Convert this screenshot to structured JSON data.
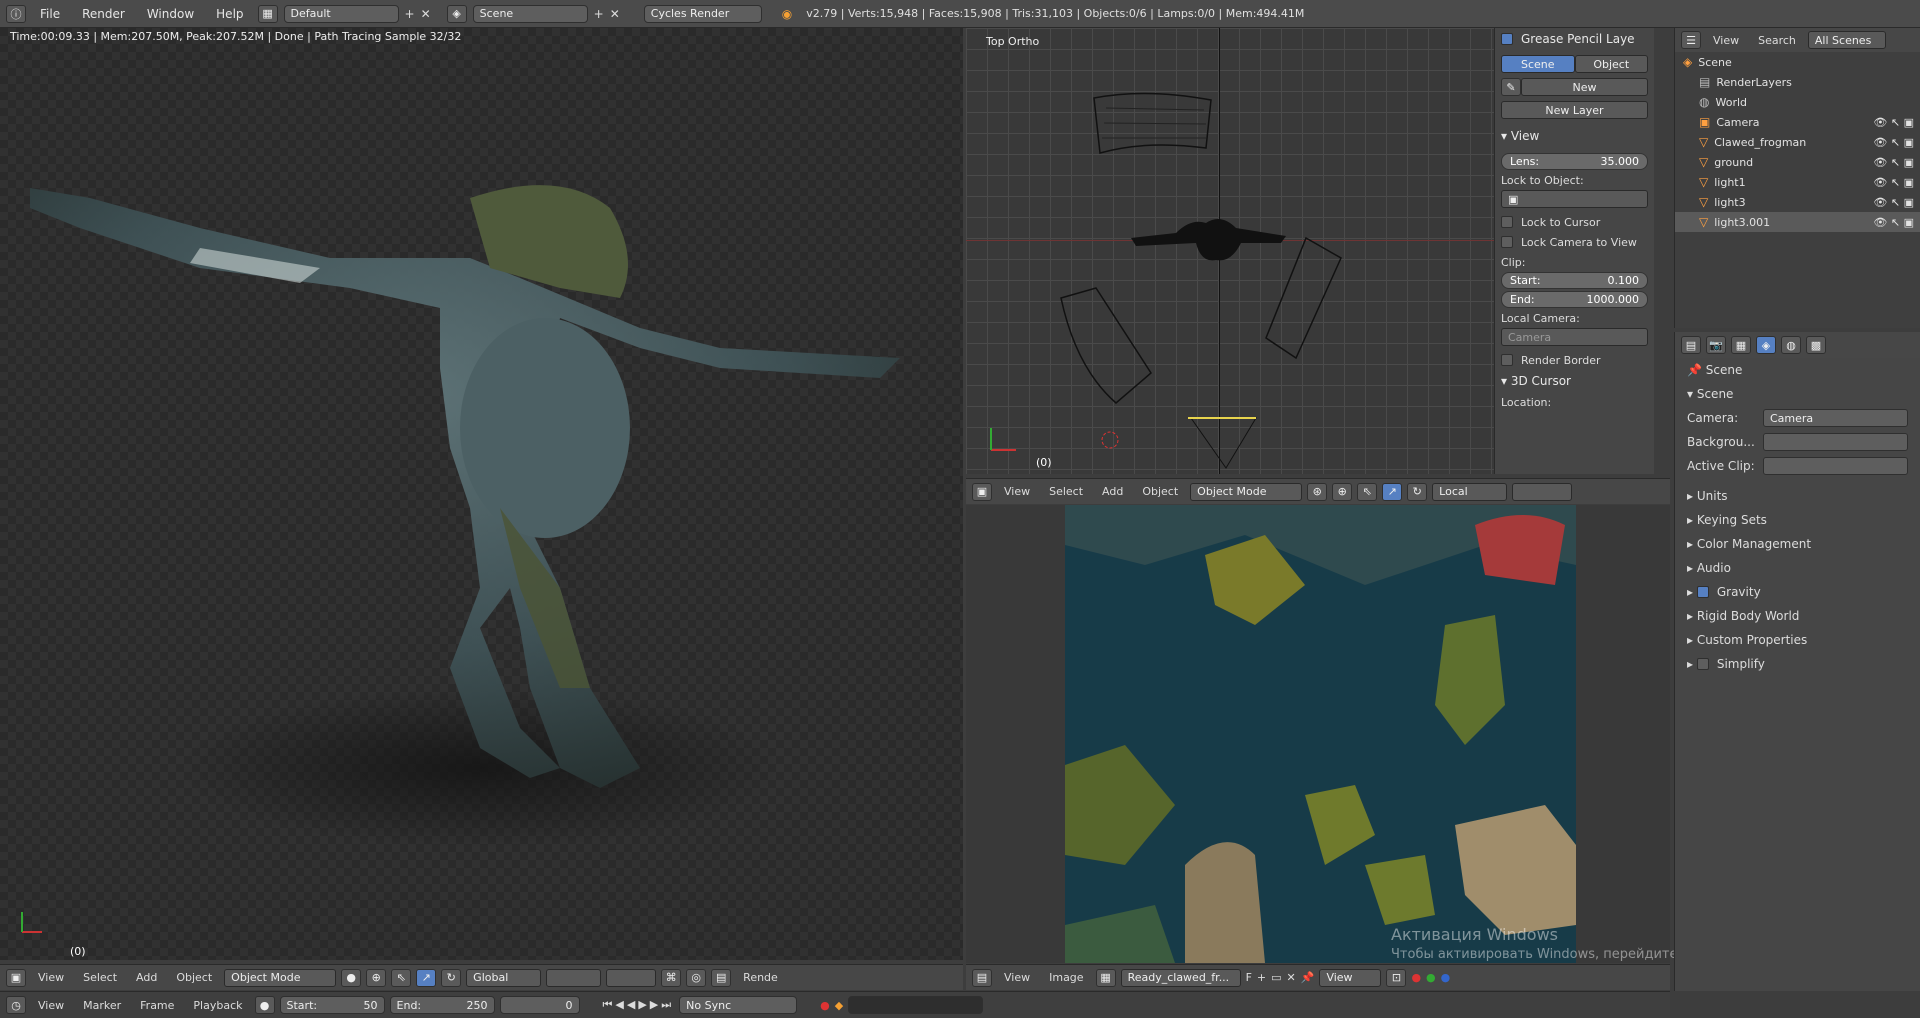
{
  "menus": {
    "file": "File",
    "render": "Render",
    "window": "Window",
    "help": "Help"
  },
  "screen_layout": "Default",
  "scene": "Scene",
  "engine": "Cycles Render",
  "stats": "v2.79 | Verts:15,948 | Faces:15,908 | Tris:31,103 | Objects:0/6 | Lamps:0/0 | Mem:494.41M",
  "render_status": "Time:00:09.33 | Mem:207.50M, Peak:207.52M | Done | Path Tracing Sample 32/32",
  "frame_marker": "(0)",
  "left_header": {
    "view": "View",
    "select": "Select",
    "add": "Add",
    "object": "Object",
    "mode": "Object Mode",
    "orientation": "Global",
    "render": "Rende"
  },
  "timeline": {
    "view": "View",
    "marker": "Marker",
    "frame": "Frame",
    "playback": "Playback",
    "start": "Start:",
    "start_val": "50",
    "end": "End:",
    "end_val": "250",
    "current": "0",
    "sync": "No Sync"
  },
  "top_view": {
    "label": "Top Ortho",
    "frame": "(0)",
    "header": {
      "view": "View",
      "select": "Select",
      "add": "Add",
      "object": "Object",
      "mode": "Object Mode",
      "pivot": "Local"
    }
  },
  "npanel": {
    "grease": "Grease Pencil Laye",
    "scene_tab": "Scene",
    "object_tab": "Object",
    "new": "New",
    "new_layer": "New Layer",
    "view_hdr": "View",
    "lens": "Lens:",
    "lens_val": "35.000",
    "lock_obj": "Lock to Object:",
    "lock_cursor": "Lock to Cursor",
    "lock_cam": "Lock Camera to View",
    "clip": "Clip:",
    "start": "Start:",
    "start_val": "0.100",
    "end": "End:",
    "end_val": "1000.000",
    "local_cam": "Local Camera:",
    "camera": "Camera",
    "render_border": "Render Border",
    "cursor_hdr": "3D Cursor",
    "location": "Location:"
  },
  "image_editor": {
    "view": "View",
    "image": "Image",
    "image_name": "Ready_clawed_fr...",
    "f": "F",
    "view2": "View"
  },
  "watermark": {
    "title": "Активация Windows",
    "sub": "Чтобы активировать Windows, перейдите в раздел \"Параметры\"."
  },
  "outliner": {
    "view": "View",
    "search": "Search",
    "all_scenes": "All Scenes",
    "items": [
      "Scene",
      "RenderLayers",
      "World",
      "Camera",
      "Clawed_frogman",
      "ground",
      "light1",
      "light3",
      "light3.001"
    ]
  },
  "properties": {
    "breadcrumb": "Scene",
    "section": "Scene",
    "camera_lbl": "Camera:",
    "camera_val": "Camera",
    "background_lbl": "Backgrou...",
    "clip_lbl": "Active Clip:",
    "panels": [
      "Units",
      "Keying Sets",
      "Color Management",
      "Audio",
      "Gravity",
      "Rigid Body World",
      "Custom Properties",
      "Simplify"
    ]
  }
}
